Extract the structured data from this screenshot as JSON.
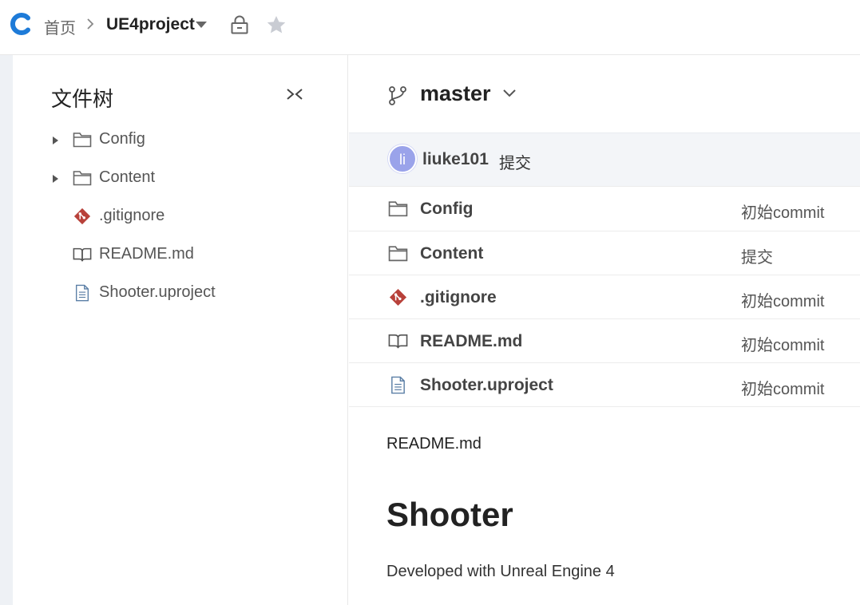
{
  "header": {
    "home_label": "首页",
    "project_name": "UE4project",
    "brand_color": "#1e7bd8"
  },
  "file_tree": {
    "title": "文件树",
    "items": [
      {
        "label": "Config",
        "icon": "folder-icon",
        "expandable": true
      },
      {
        "label": "Content",
        "icon": "folder-icon",
        "expandable": true
      },
      {
        "label": ".gitignore",
        "icon": "git-icon",
        "expandable": false
      },
      {
        "label": "README.md",
        "icon": "book-icon",
        "expandable": false
      },
      {
        "label": "Shooter.uproject",
        "icon": "file-icon",
        "expandable": false
      }
    ]
  },
  "branch": {
    "name": "master"
  },
  "latest_commit": {
    "avatar_initials": "li",
    "user": "liuke101",
    "message": "提交"
  },
  "files": [
    {
      "name": "Config",
      "icon": "folder-icon",
      "commit": "初始commit"
    },
    {
      "name": "Content",
      "icon": "folder-icon",
      "commit": "提交"
    },
    {
      "name": ".gitignore",
      "icon": "git-icon",
      "commit": "初始commit"
    },
    {
      "name": "README.md",
      "icon": "book-icon",
      "commit": "初始commit"
    },
    {
      "name": "Shooter.uproject",
      "icon": "file-icon",
      "commit": "初始commit"
    }
  ],
  "readme": {
    "label": "README.md",
    "heading": "Shooter",
    "paragraph": "Developed with Unreal Engine 4"
  },
  "colors": {
    "git_icon": "#b8413a",
    "file_icon": "#5b7fa6",
    "avatar_bg": "#9aa3ea"
  }
}
